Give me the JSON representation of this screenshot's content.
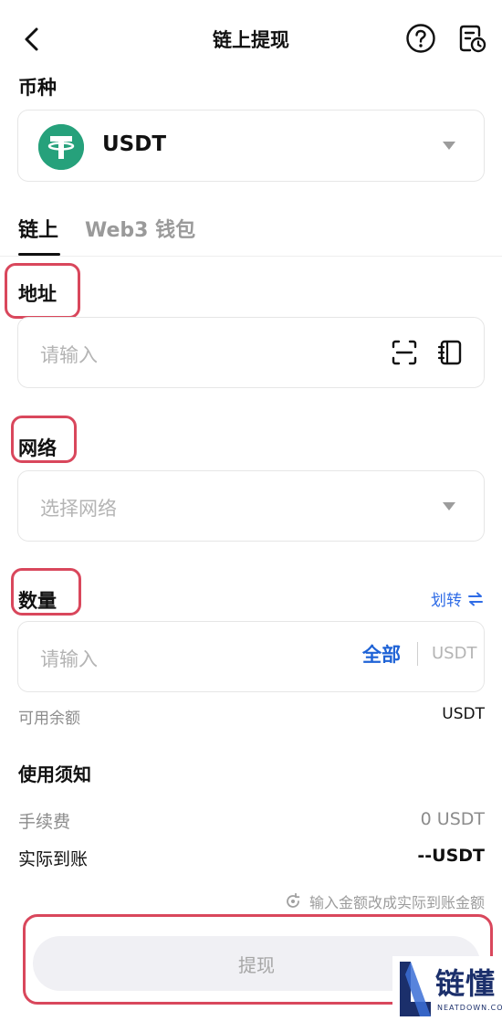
{
  "header": {
    "title": "链上提现"
  },
  "currency": {
    "label": "币种",
    "name": "USDT"
  },
  "tabs": [
    {
      "label": "链上"
    },
    {
      "label": "Web3 钱包"
    }
  ],
  "address": {
    "label": "地址",
    "placeholder": "请输入"
  },
  "network": {
    "label": "网络",
    "placeholder": "选择网络"
  },
  "amount": {
    "label": "数量",
    "transfer_link": "划转",
    "placeholder": "请输入",
    "all_button": "全部",
    "unit": "USDT",
    "available_label": "可用余额",
    "available_unit": "USDT"
  },
  "notice": {
    "title": "使用须知",
    "fee_label": "手续费",
    "fee_value": "0 USDT",
    "receive_label": "实际到账",
    "receive_value": "--USDT",
    "hint": "输入金额改成实际到账金额"
  },
  "submit": {
    "label": "提现"
  },
  "watermark": {
    "text": "链懂",
    "sub": "NEATDOWN.COM"
  },
  "colors": {
    "accent": "#1f63d6",
    "tether": "#26a17b",
    "highlight": "#d9475c"
  },
  "icons": [
    "back-arrow-icon",
    "help-icon",
    "history-icon",
    "tether-icon",
    "caret-down-icon",
    "scan-icon",
    "address-book-icon",
    "swap-icon",
    "refresh-icon"
  ]
}
